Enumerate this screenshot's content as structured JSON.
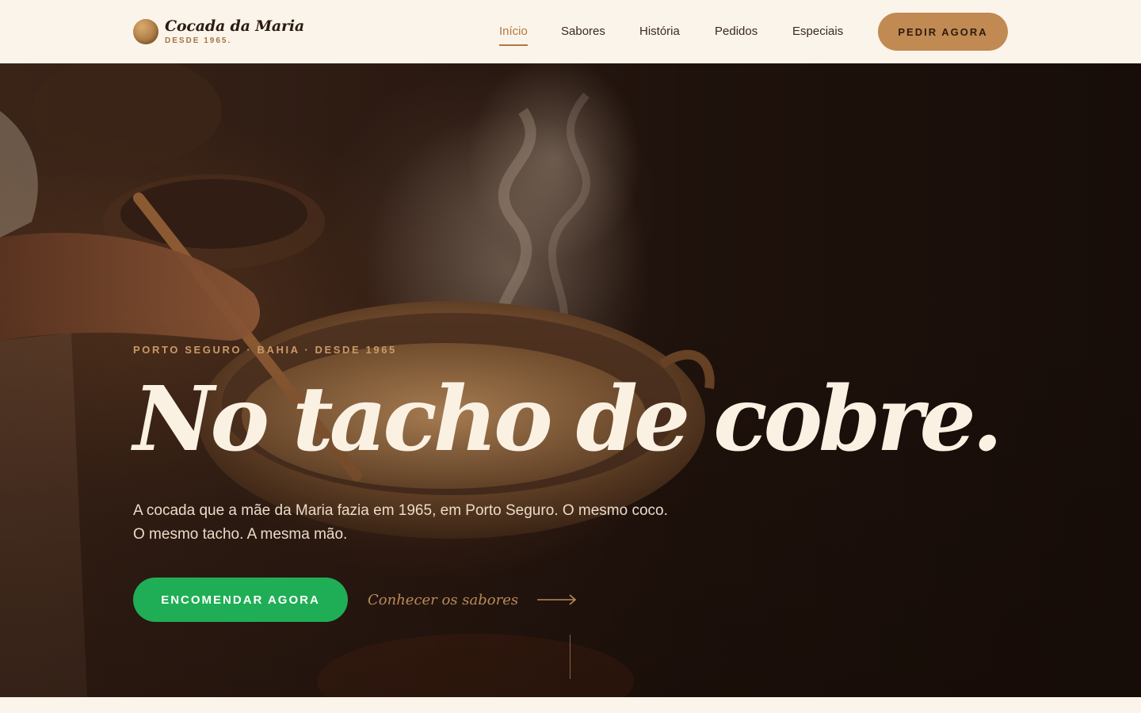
{
  "brand": {
    "name": "Cocada da Maria",
    "tagline": "DESDE 1965."
  },
  "nav": {
    "items": [
      {
        "label": "Início",
        "active": true
      },
      {
        "label": "Sabores",
        "active": false
      },
      {
        "label": "História",
        "active": false
      },
      {
        "label": "Pedidos",
        "active": false
      },
      {
        "label": "Especiais",
        "active": false
      }
    ],
    "cta_label": "PEDIR AGORA"
  },
  "hero": {
    "eyebrow": "PORTO SEGURO · BAHIA · DESDE 1965",
    "headline": "No tacho de cobre.",
    "subtext": "A cocada que a mãe da Maria fazia em 1965, em Porto Seguro. O mesmo coco. O mesmo tacho. A mesma mão.",
    "primary_cta": "ENCOMENDAR AGORA",
    "secondary_cta": "Conhecer os sabores",
    "secondary_icon": "arrow-right-icon",
    "background_image": "copper-pot-cooking-image"
  },
  "colors": {
    "background": "#fbf4ea",
    "accent": "#b4773f",
    "cta_top": "#c08a52",
    "cta_primary": "#1fae55",
    "hero_dark": "#1f120c",
    "headline": "#fbf1e3"
  }
}
